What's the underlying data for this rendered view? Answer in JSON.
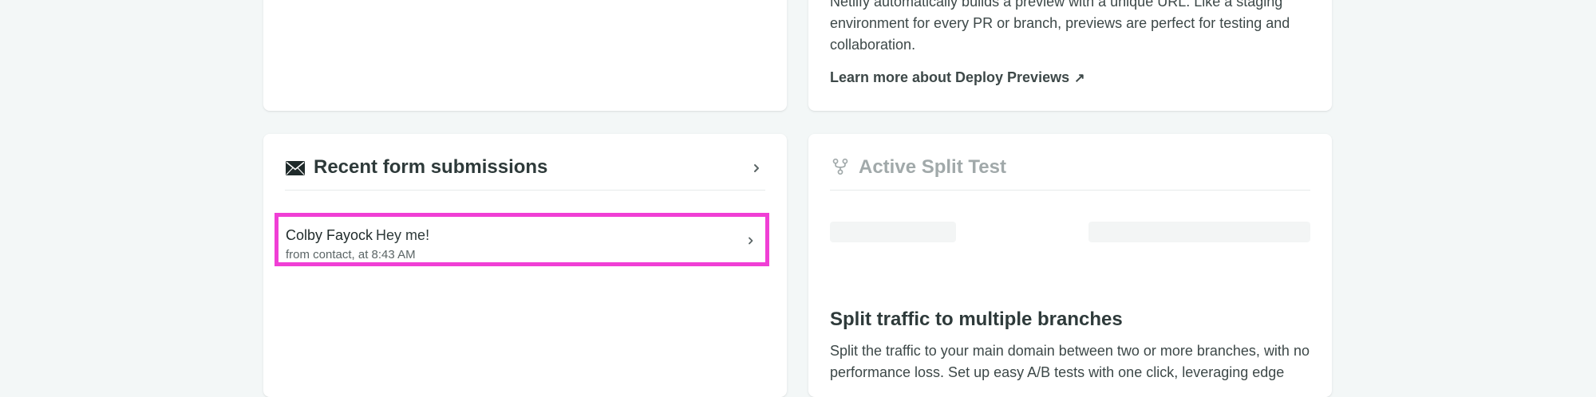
{
  "deploy_previews": {
    "description": "Netlify automatically builds a preview with a unique URL. Like a staging environment for every PR or branch, previews are perfect for testing and collaboration.",
    "learn_more": "Learn more about Deploy Previews",
    "learn_more_icon": "arrow-up-right-icon"
  },
  "forms": {
    "title": "Recent form submissions",
    "title_icon": "envelope-icon",
    "submissions": [
      {
        "name": "Colby Fayock",
        "message": "Hey me!",
        "meta": "from contact, at 8:43 AM"
      }
    ],
    "highlight_color": "#f03fd5"
  },
  "split_test": {
    "title": "Active Split Test",
    "title_icon": "branch-fork-icon",
    "heading": "Split traffic to multiple branches",
    "description": "Split the traffic to your main domain between two or more branches, with no performance loss. Set up easy A/B tests with one click, leveraging edge"
  }
}
